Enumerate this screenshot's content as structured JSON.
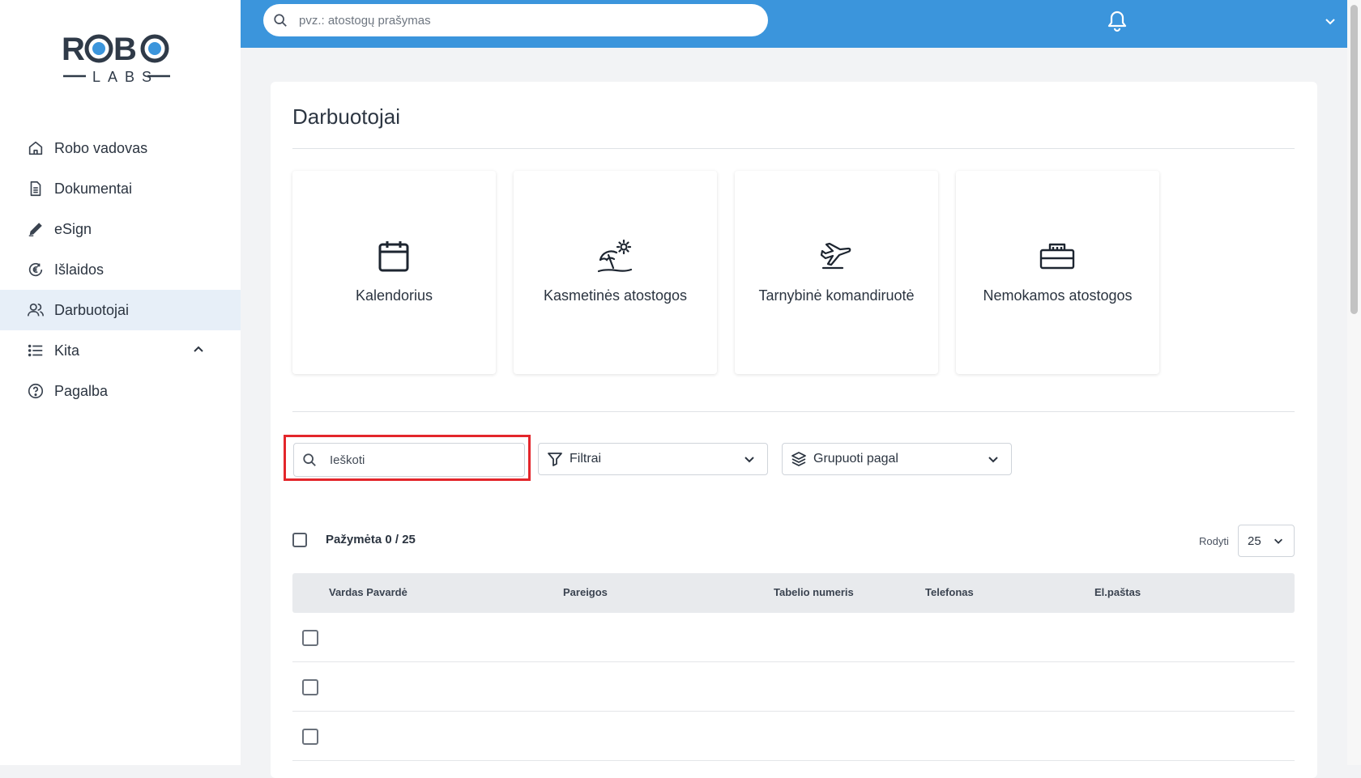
{
  "app": {
    "logo_text": "ROBO LABS"
  },
  "sidebar": {
    "items": [
      {
        "label": "Robo vadovas",
        "icon": "home-icon"
      },
      {
        "label": "Dokumentai",
        "icon": "document-icon"
      },
      {
        "label": "eSign",
        "icon": "pen-icon"
      },
      {
        "label": "Išlaidos",
        "icon": "euro-icon"
      },
      {
        "label": "Darbuotojai",
        "icon": "users-icon",
        "active": true
      },
      {
        "label": "Kita",
        "icon": "list-icon",
        "expanded": true
      },
      {
        "label": "Pagalba",
        "icon": "help-icon"
      }
    ]
  },
  "topbar": {
    "search_placeholder": "pvz.: atostogų prašymas",
    "bell_icon": "bell-icon",
    "menu_icon": "chevron-down-icon",
    "color": "#3b95dc"
  },
  "page": {
    "title": "Darbuotojai"
  },
  "tiles": [
    {
      "label": "Kalendorius",
      "icon": "calendar-icon"
    },
    {
      "label": "Kasmetinės atostogos",
      "icon": "beach-umbrella-icon"
    },
    {
      "label": "Tarnybinė komandiruotė",
      "icon": "airplane-icon"
    },
    {
      "label": "Nemokamos atostogos",
      "icon": "toolbox-icon"
    }
  ],
  "toolbar": {
    "search_placeholder": "Ieškoti",
    "filters_label": "Filtrai",
    "group_by_label": "Grupuoti pagal"
  },
  "selection": {
    "selected_text": "Pažymėta 0 / 25",
    "show_label": "Rodyti",
    "page_size": "25"
  },
  "table": {
    "columns": [
      "Vardas Pavardė",
      "Pareigos",
      "Tabelio numeris",
      "Telefonas",
      "El.paštas"
    ],
    "rows": [
      {
        "name": "",
        "position": "",
        "id": "",
        "phone": "",
        "email": ""
      },
      {
        "name": "",
        "position": "",
        "id": "",
        "phone": "",
        "email": ""
      },
      {
        "name": "",
        "position": "",
        "id": "",
        "phone": "",
        "email": ""
      }
    ]
  },
  "colors": {
    "accent": "#3b95dc",
    "highlight": "#e3262b",
    "active_nav": "#e7eff8"
  }
}
